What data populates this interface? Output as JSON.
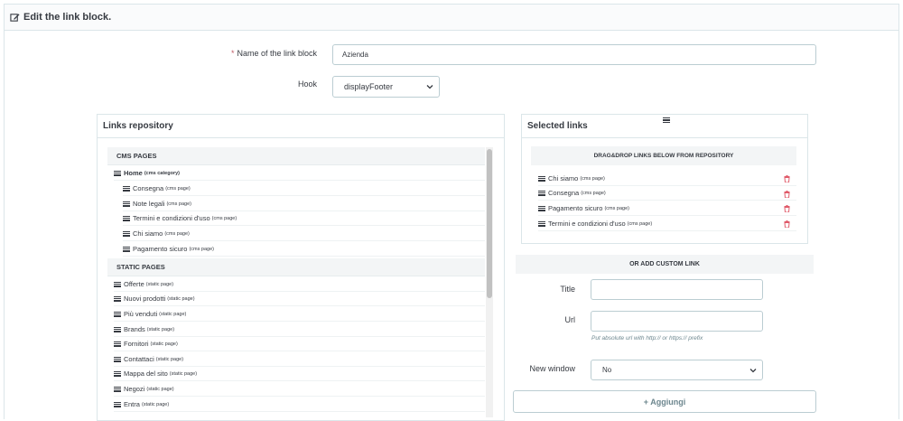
{
  "panel": {
    "title": "Edit the link block."
  },
  "form": {
    "name_label": "Name of the link block",
    "name_required": "*",
    "name_value": "Azienda",
    "hook_label": "Hook",
    "hook_value": "displayFooter"
  },
  "repository": {
    "title": "Links repository",
    "cms_header": "CMS PAGES",
    "cms_items": [
      {
        "label": "Home",
        "type": "(cms category)"
      },
      {
        "label": "Consegna",
        "type": "(cms page)"
      },
      {
        "label": "Note legali",
        "type": "(cms page)"
      },
      {
        "label": "Termini e condizioni d'uso",
        "type": "(cms page)"
      },
      {
        "label": "Chi siamo",
        "type": "(cms page)"
      },
      {
        "label": "Pagamento sicuro",
        "type": "(cms page)"
      }
    ],
    "static_header": "STATIC PAGES",
    "static_items": [
      {
        "label": "Offerte",
        "type": "(static page)"
      },
      {
        "label": "Nuovi prodotti",
        "type": "(static page)"
      },
      {
        "label": "Più venduti",
        "type": "(static page)"
      },
      {
        "label": "Brands",
        "type": "(static page)"
      },
      {
        "label": "Fornitori",
        "type": "(static page)"
      },
      {
        "label": "Contattaci",
        "type": "(static page)"
      },
      {
        "label": "Mappa del sito",
        "type": "(static page)"
      },
      {
        "label": "Negozi",
        "type": "(static page)"
      },
      {
        "label": "Entra",
        "type": "(static page)"
      }
    ]
  },
  "selected": {
    "title": "Selected links",
    "drop_header": "DRAG&DROP LINKS BELOW FROM REPOSITORY",
    "items": [
      {
        "label": "Chi siamo",
        "type": "(cms page)"
      },
      {
        "label": "Consegna",
        "type": "(cms page)"
      },
      {
        "label": "Pagamento sicuro",
        "type": "(cms page)"
      },
      {
        "label": "Termini e condizioni d'uso",
        "type": "(cms page)"
      }
    ]
  },
  "custom": {
    "header": "OR ADD CUSTOM LINK",
    "title_label": "Title",
    "title_value": "",
    "url_label": "Url",
    "url_value": "",
    "url_hint": "Put absolute url with http:// or https:// prefix",
    "new_window_label": "New window",
    "new_window_value": "No",
    "add_button": "+ Aggiungi"
  },
  "colors": {
    "trash": "#e05c6b",
    "border": "#dbe6e9",
    "required": "#c05c67"
  }
}
